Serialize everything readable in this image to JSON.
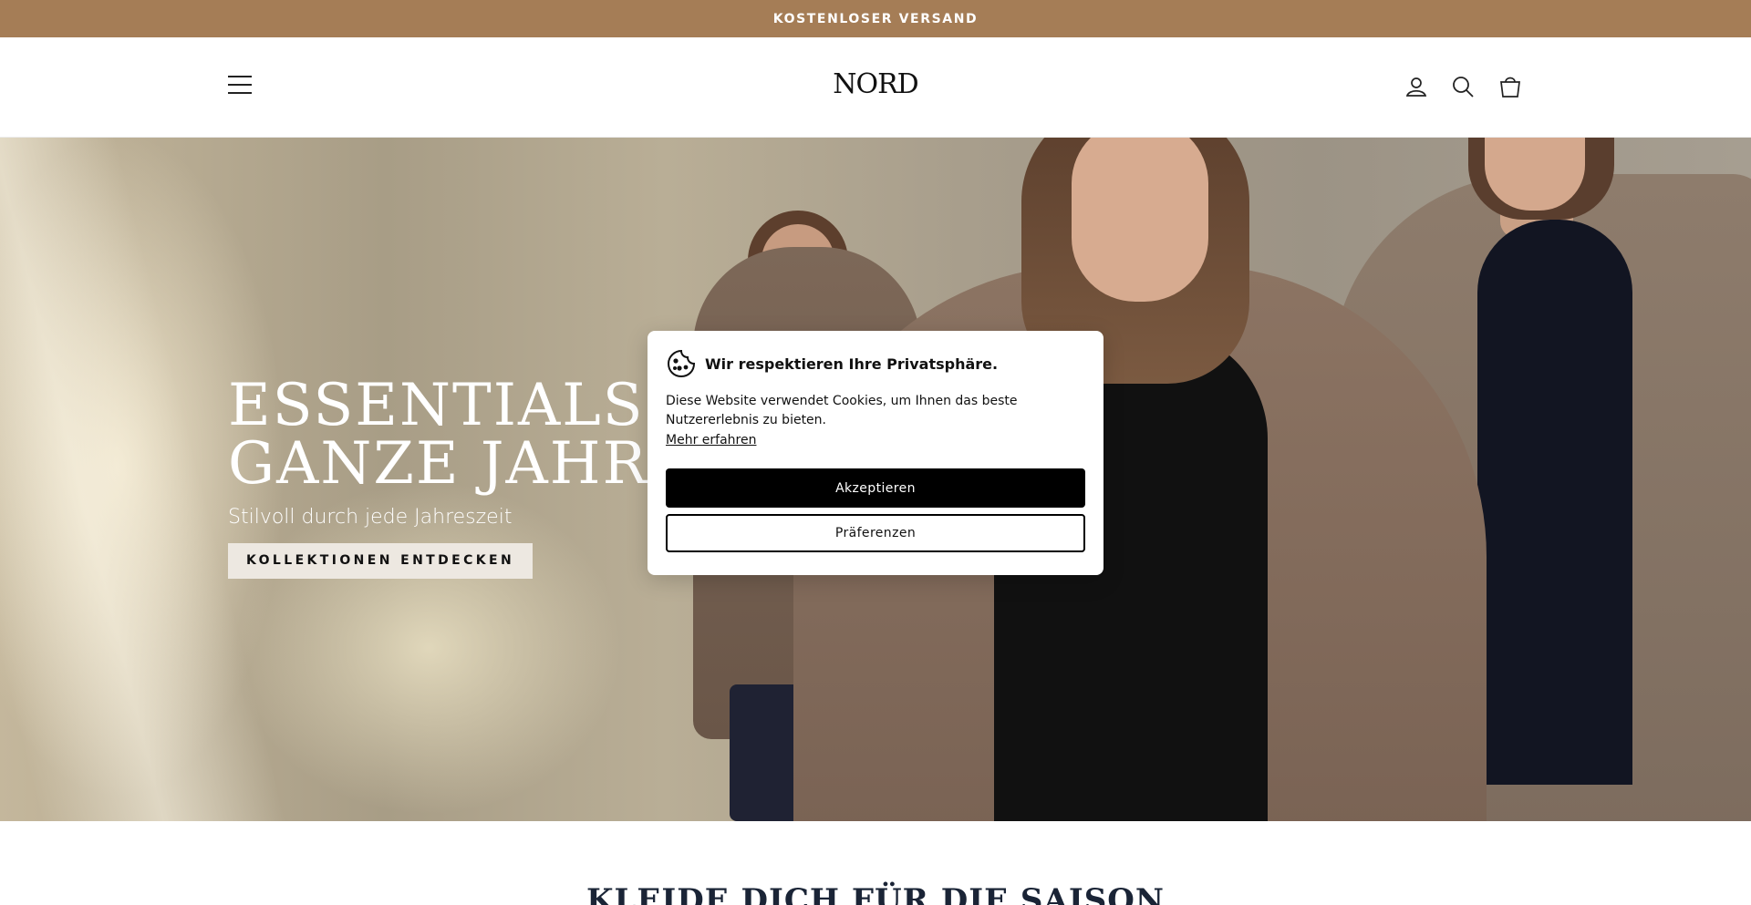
{
  "announcement": {
    "text": "KOSTENLOSER VERSAND"
  },
  "header": {
    "logo": "NORD",
    "icons": {
      "menu": "menu-icon",
      "account": "user-icon",
      "search": "search-icon",
      "cart": "shopping-bag-icon"
    }
  },
  "hero": {
    "title": "ESSENTIALS F\nGANZE JAHR",
    "subtitle": "Stilvoll durch jede Jahreszeit",
    "cta_label": "KOLLEKTIONEN ENTDECKEN"
  },
  "section": {
    "heading": "KLEIDE DICH FÜR DIE SAISON"
  },
  "cookie_banner": {
    "icon": "cookie-icon",
    "title": "Wir respektieren Ihre Privatsphäre.",
    "text": "Diese Website verwendet Cookies, um Ihnen das beste Nutzererlebnis zu bieten.",
    "link_label": "Mehr erfahren",
    "accept_label": "Akzeptieren",
    "preferences_label": "Präferenzen"
  },
  "colors": {
    "announcement_bg": "#a57d56",
    "button_primary": "#000000",
    "cta_bg": "#ede8e1"
  }
}
